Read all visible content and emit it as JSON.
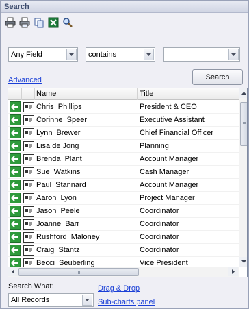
{
  "panel": {
    "title": "Search"
  },
  "toolbar": {
    "buttons": [
      "print-icon",
      "print-preview-icon",
      "copy-icon",
      "excel-export-icon",
      "find-icon"
    ]
  },
  "criteria": {
    "field": "Any Field",
    "operator": "contains",
    "value": ""
  },
  "links": {
    "advanced": "Advanced",
    "drag_drop": "Drag & Drop",
    "subcharts": "Sub-charts panel"
  },
  "search_button": "Search",
  "grid": {
    "columns": {
      "name": "Name",
      "title": "Title"
    },
    "rows": [
      {
        "name": "Chris  Phillips",
        "title": "President & CEO"
      },
      {
        "name": "Corinne  Speer",
        "title": "Executive Assistant"
      },
      {
        "name": "Lynn  Brewer",
        "title": "Chief Financial Officer"
      },
      {
        "name": "Lisa de Jong",
        "title": "Planning"
      },
      {
        "name": "Brenda  Plant",
        "title": "Account Manager"
      },
      {
        "name": "Sue  Watkins",
        "title": "Cash Manager"
      },
      {
        "name": "Paul  Stannard",
        "title": "Account Manager"
      },
      {
        "name": "Aaron  Lyon",
        "title": "Project Manager"
      },
      {
        "name": "Jason  Peele",
        "title": "Coordinator"
      },
      {
        "name": "Joanne  Barr",
        "title": "Coordinator"
      },
      {
        "name": "Rushford  Maloney",
        "title": "Coordinator"
      },
      {
        "name": "Craig  Stantz",
        "title": "Coordinator"
      },
      {
        "name": "Becci  Seuberling",
        "title": "Vice President"
      }
    ]
  },
  "search_what": {
    "label": "Search What:",
    "selected": "All Records"
  },
  "colors": {
    "link": "#1a3fd6",
    "action_icon": "#2e9a3b"
  }
}
